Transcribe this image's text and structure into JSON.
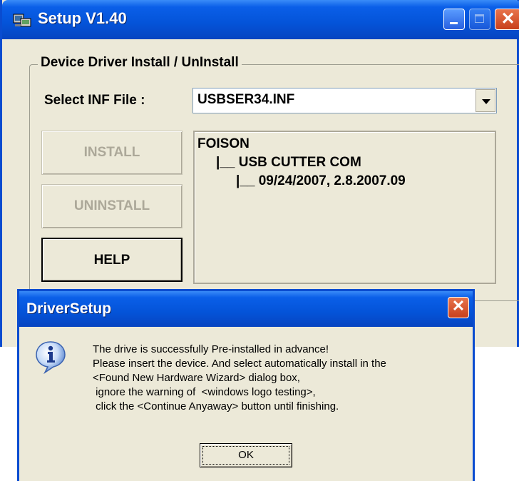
{
  "main_window": {
    "title": "Setup V1.40",
    "icon": "setup-app-icon",
    "group_label": "Device Driver Install / UnInstall",
    "inf_label": "Select INF File :",
    "inf_value": "USBSER34.INF",
    "buttons": {
      "install": "INSTALL",
      "uninstall": "UNINSTALL",
      "help": "HELP"
    },
    "tree": {
      "line1": "FOISON",
      "line2": "|__ USB CUTTER COM",
      "line3": "|__ 09/24/2007, 2.8.2007.09"
    }
  },
  "dialog": {
    "title": "DriverSetup",
    "icon": "info-icon",
    "message": {
      "line1": "The drive is successfully Pre-installed in advance!",
      "line2": "Please insert the device. And select automatically install in the",
      "line3": "<Found New Hardware Wizard> dialog box,",
      "line4": " ignore the warning of  <windows logo testing>,",
      "line5": " click the <Continue Anyaway> button until finishing."
    },
    "ok_label": "OK"
  },
  "colors": {
    "titlebar": "#0453d8",
    "window_bg": "#ece9d8",
    "close_button": "#c8401c",
    "disabled_text": "#aca899"
  }
}
